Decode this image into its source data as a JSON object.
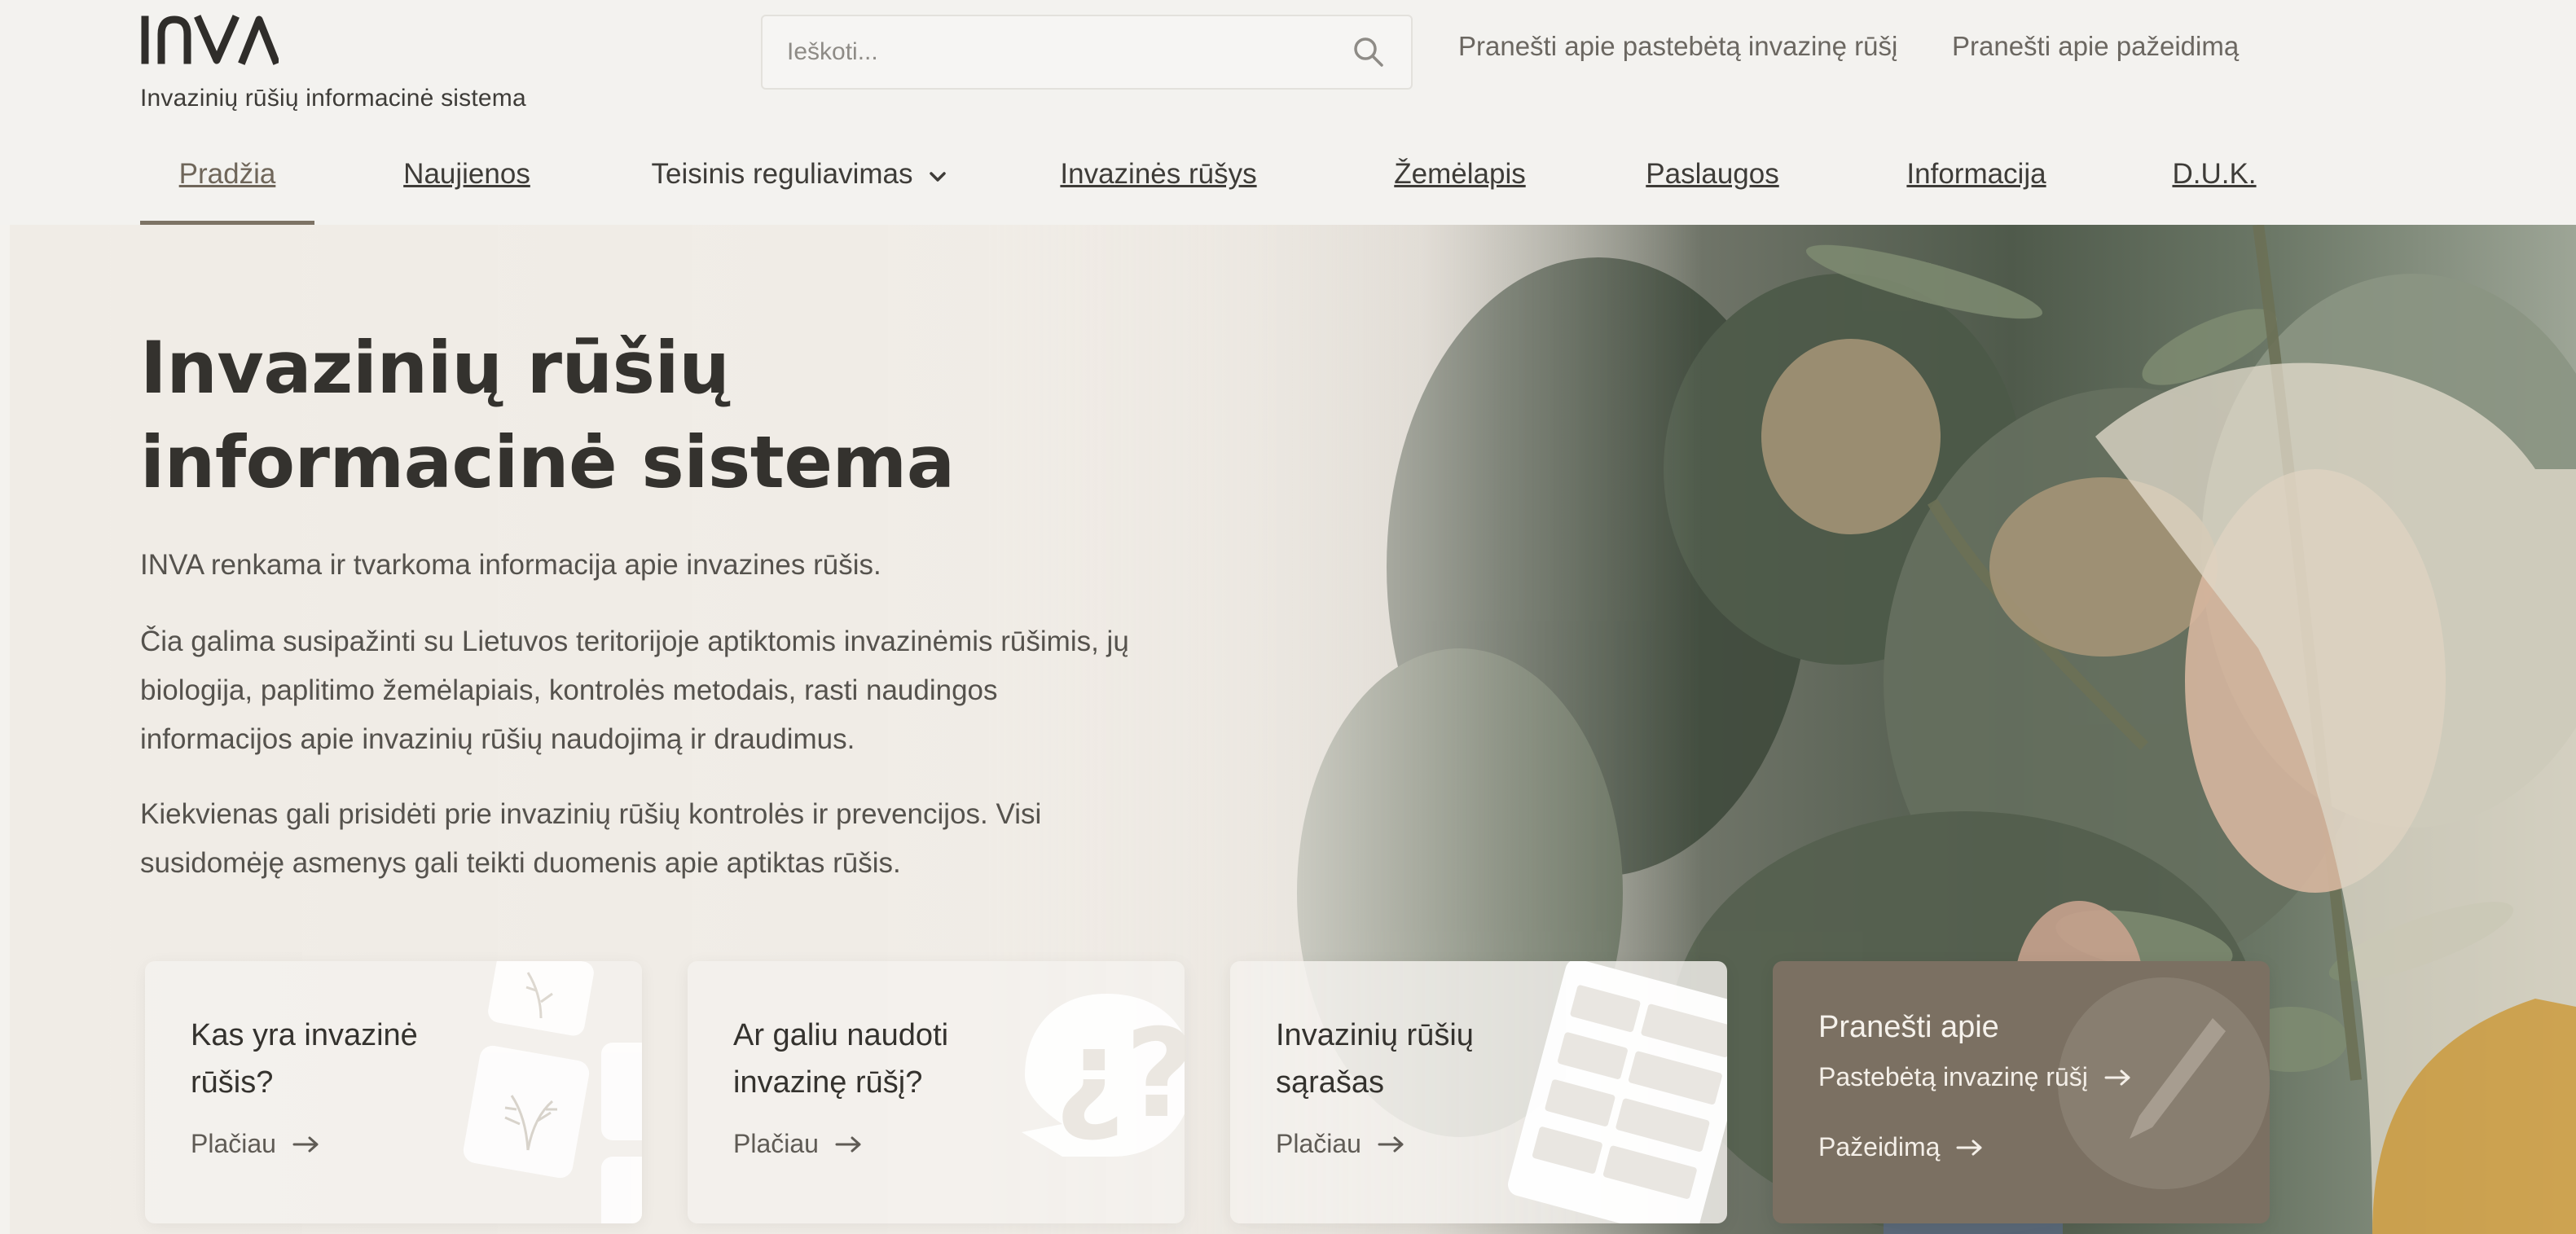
{
  "header": {
    "logo_text": "INVA",
    "logo_subtitle": "Invazinių rūšių informacinė sistema",
    "search_placeholder": "Ieškoti...",
    "top_links": [
      "Pranešti apie pastebėtą invazinę rūšį",
      "Pranešti apie pažeidimą"
    ]
  },
  "nav": {
    "items": [
      "Pradžia",
      "Naujienos",
      "Teisinis reguliavimas",
      "Invazinės rūšys",
      "Žemėlapis",
      "Paslaugos",
      "Informacija",
      "D.U.K."
    ],
    "active": "Pradžia"
  },
  "hero": {
    "title_line1": "Invazinių rūšių",
    "title_line2": "informacinė sistema",
    "paragraph1": "INVA renkama ir tvarkoma informacija apie invazines rūšis.",
    "paragraph2": "Čia galima susipažinti su Lietuvos teritorijoje aptiktomis invazinėmis rūšimis, jų biologija, paplitimo žemėlapiais, kontrolės metodais, rasti naudingos informacijos apie invazinių rūšių naudojimą ir draudimus.",
    "paragraph3": "Kiekvienas gali prisidėti prie invazinių rūšių kontrolės ir prevencijos. Visi susidomėję asmenys gali teikti duomenis apie aptiktas rūšis."
  },
  "cards": [
    {
      "title": "Kas yra invazinė rūšis?",
      "link": "Plačiau"
    },
    {
      "title": "Ar galiu naudoti invazinę rūšį?",
      "link": "Plačiau"
    },
    {
      "title": "Invazinių rūšių sąrašas",
      "link": "Plačiau"
    }
  ],
  "report_card": {
    "title": "Pranešti apie",
    "links": [
      "Pastebėtą invazinę rūšį",
      "Pažeidimą"
    ]
  },
  "colors": {
    "accent": "#7b7062",
    "text": "#34322e",
    "muted": "#6b6761",
    "page_bg": "#f3f2ef"
  }
}
